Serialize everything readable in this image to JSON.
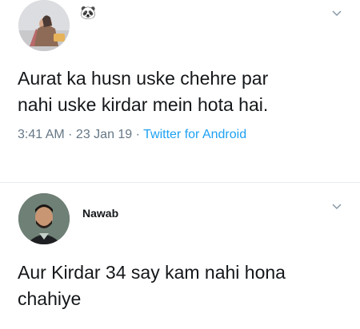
{
  "tweet1": {
    "display_name": "🐼",
    "text": "Aurat ka husn uske chehre par\nnahi uske kirdar mein hota hai.",
    "time": "3:41 AM",
    "separator1": " · ",
    "date": "23 Jan 19",
    "separator2": " · ",
    "source": "Twitter for Android"
  },
  "tweet2": {
    "display_name": "Nawab",
    "text": "Aur Kirdar 34 say kam nahi hona\nchahiye"
  },
  "colors": {
    "text": "#14171a",
    "meta_gray": "#657786",
    "link_blue": "#1da1f2",
    "divider": "#e6ecf0"
  },
  "icons": [
    "chevron-down-icon",
    "avatar",
    "panda-emoji"
  ]
}
